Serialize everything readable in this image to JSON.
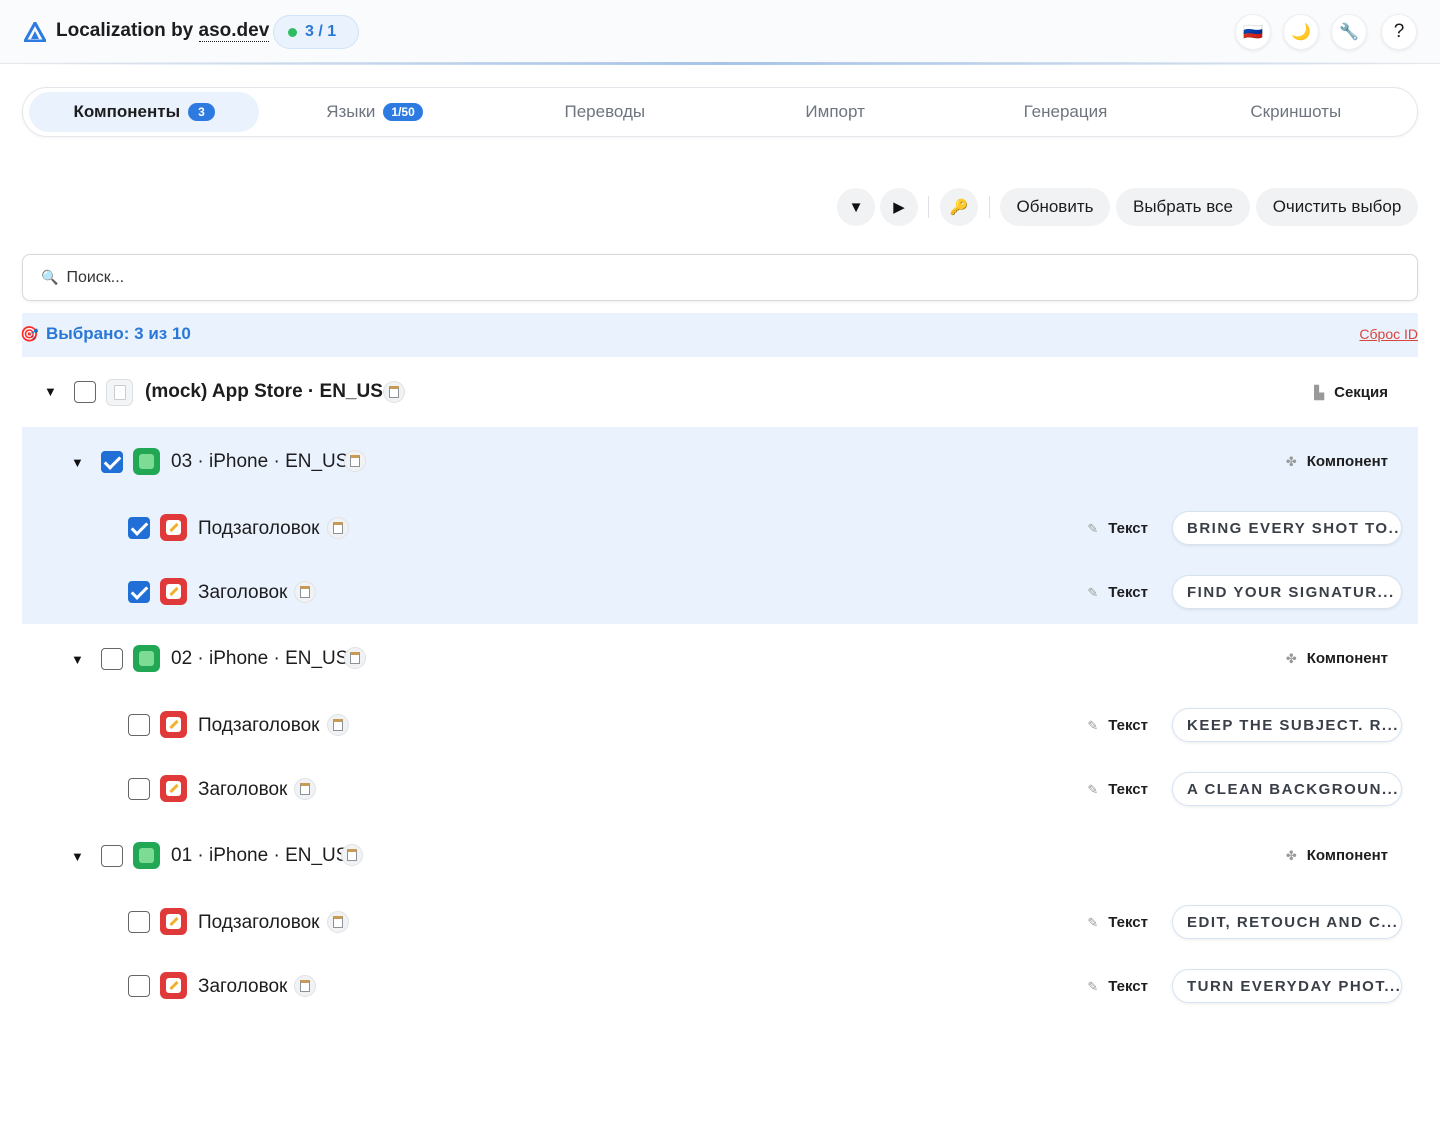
{
  "header": {
    "app_name_prefix": "Localization by ",
    "app_name_link": "aso.dev",
    "counter": "3 / 1",
    "flag_icon": "🇷🇺",
    "theme_icon": "🌙",
    "tools_icon": "🔧",
    "help_label": "?"
  },
  "tabs": [
    {
      "label": "Компоненты",
      "badge": "3"
    },
    {
      "label": "Языки",
      "badge": "1/50"
    },
    {
      "label": "Переводы"
    },
    {
      "label": "Импорт"
    },
    {
      "label": "Генерация"
    },
    {
      "label": "Скриншоты"
    }
  ],
  "toolbar": {
    "collapse_icon": "▼",
    "expand_icon": "▶",
    "key_icon": "🔑",
    "refresh_label": "Обновить",
    "select_all_label": "Выбрать все",
    "clear_label": "Очистить выбор"
  },
  "search": {
    "placeholder": "Поиск...",
    "icon": "🔍"
  },
  "selection": {
    "text": "Выбрано: 3 из 10",
    "icon": "🎯",
    "reset_label": "Сброс ID"
  },
  "tree": {
    "root": {
      "label": "(mock) App Store · EN_US",
      "kind": "Секция",
      "checked": false
    },
    "components": [
      {
        "label": "03 · iPhone · EN_US",
        "kind": "Компонент",
        "checked": true,
        "children": [
          {
            "label": "Подзаголовок",
            "kind": "Текст",
            "value": "BRING EVERY SHOT TO...",
            "checked": true
          },
          {
            "label": "Заголовок",
            "kind": "Текст",
            "value": "FIND YOUR SIGNATUR...",
            "checked": true
          }
        ]
      },
      {
        "label": "02 · iPhone · EN_US",
        "kind": "Компонент",
        "checked": false,
        "children": [
          {
            "label": "Подзаголовок",
            "kind": "Текст",
            "value": "KEEP THE SUBJECT. R...",
            "checked": false
          },
          {
            "label": "Заголовок",
            "kind": "Текст",
            "value": "A CLEAN BACKGROUN...",
            "checked": false
          }
        ]
      },
      {
        "label": "01 · iPhone · EN_US",
        "kind": "Компонент",
        "checked": false,
        "children": [
          {
            "label": "Подзаголовок",
            "kind": "Текст",
            "value": "EDIT, RETOUCH AND C...",
            "checked": false
          },
          {
            "label": "Заголовок",
            "kind": "Текст",
            "value": "TURN EVERYDAY PHOT...",
            "checked": false
          }
        ]
      }
    ]
  }
}
